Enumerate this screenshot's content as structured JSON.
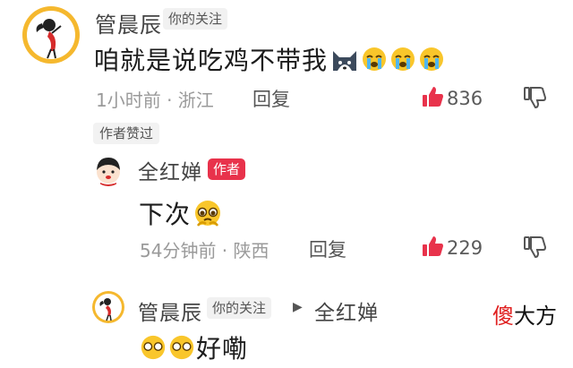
{
  "comment1": {
    "username": "管晨辰",
    "follow_tag": "你的关注",
    "text": "咱就是说吃鸡不带我",
    "time_location": "1小时前 · 浙江",
    "reply_label": "回复",
    "likes": "836",
    "author_liked_tag": "作者赞过"
  },
  "reply1": {
    "username": "全红婵",
    "author_badge": "作者",
    "text": "下次",
    "time_location": "54分钟前 · 陕西",
    "reply_label": "回复",
    "likes": "229"
  },
  "reply2": {
    "username": "管晨辰",
    "follow_tag": "你的关注",
    "arrow": "▶",
    "reply_to": "全红婵",
    "text": "好嘞"
  },
  "watermark": {
    "part1": "傻",
    "part2": "大方"
  },
  "colors": {
    "like_red": "#e8324b",
    "author_badge": "#e8324b",
    "avatar_yellow": "#f5b82e",
    "watermark_red": "#e02020"
  }
}
